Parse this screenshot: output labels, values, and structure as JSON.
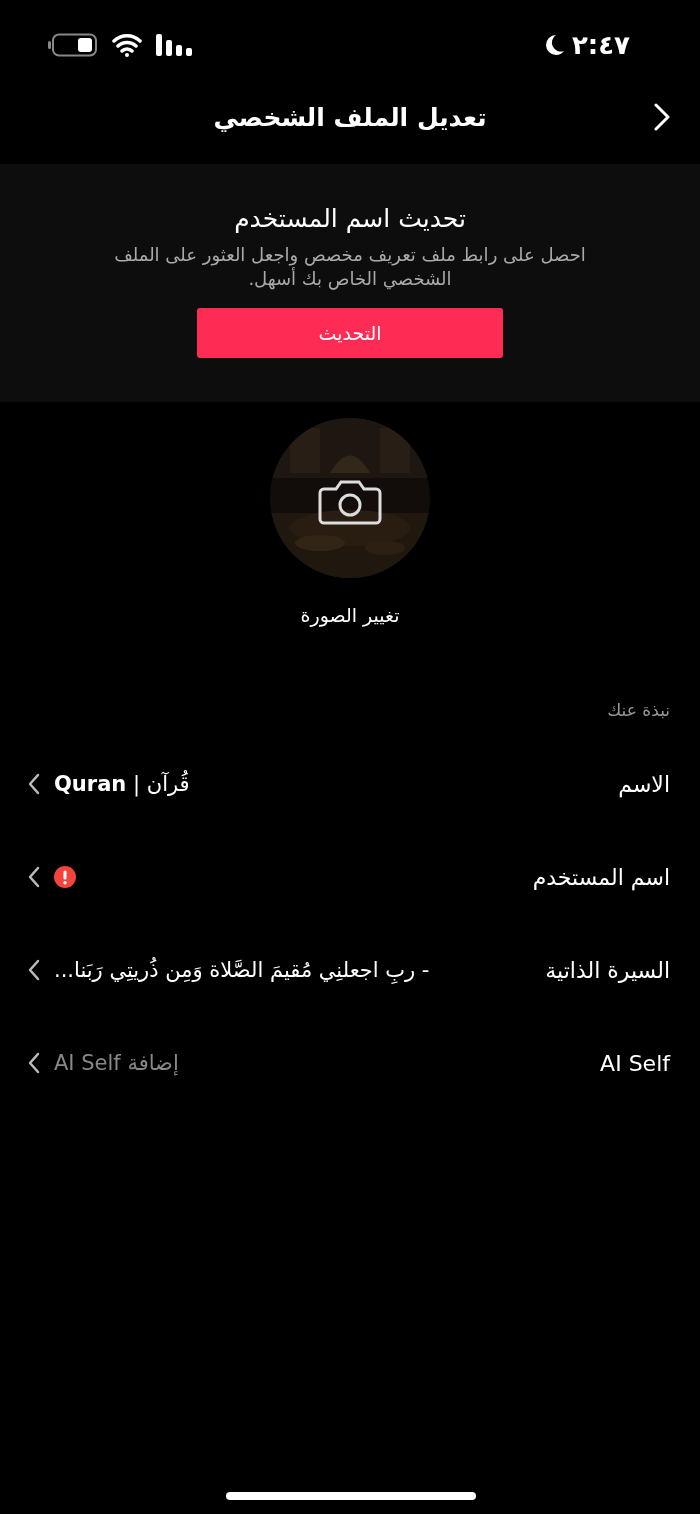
{
  "status_bar": {
    "time": "٢:٤٧"
  },
  "header": {
    "title": "تعديل الملف الشخصي"
  },
  "banner": {
    "title": "تحديث اسم المستخدم",
    "text": "احصل على رابط ملف تعريف مخصص واجعل العثور على الملف الشخصي الخاص بك أسهل.",
    "button": "التحديث"
  },
  "photo": {
    "label": "تغيير الصورة"
  },
  "section": {
    "title": "نبذة عنك"
  },
  "rows": [
    {
      "label": "الاسم",
      "kind": "text",
      "value": "قُرآن | **Quran**"
    },
    {
      "label": "اسم المستخدم",
      "kind": "warning"
    },
    {
      "label": "السيرة الذاتية",
      "kind": "text",
      "value": "-   ربِ اجعلنِي مُقيمَ الصَّلاة وَمِن ذُريتِي رَبَنا..."
    },
    {
      "label": "AI Self",
      "kind": "placeholder",
      "value": "إضافة AI Self"
    }
  ]
}
